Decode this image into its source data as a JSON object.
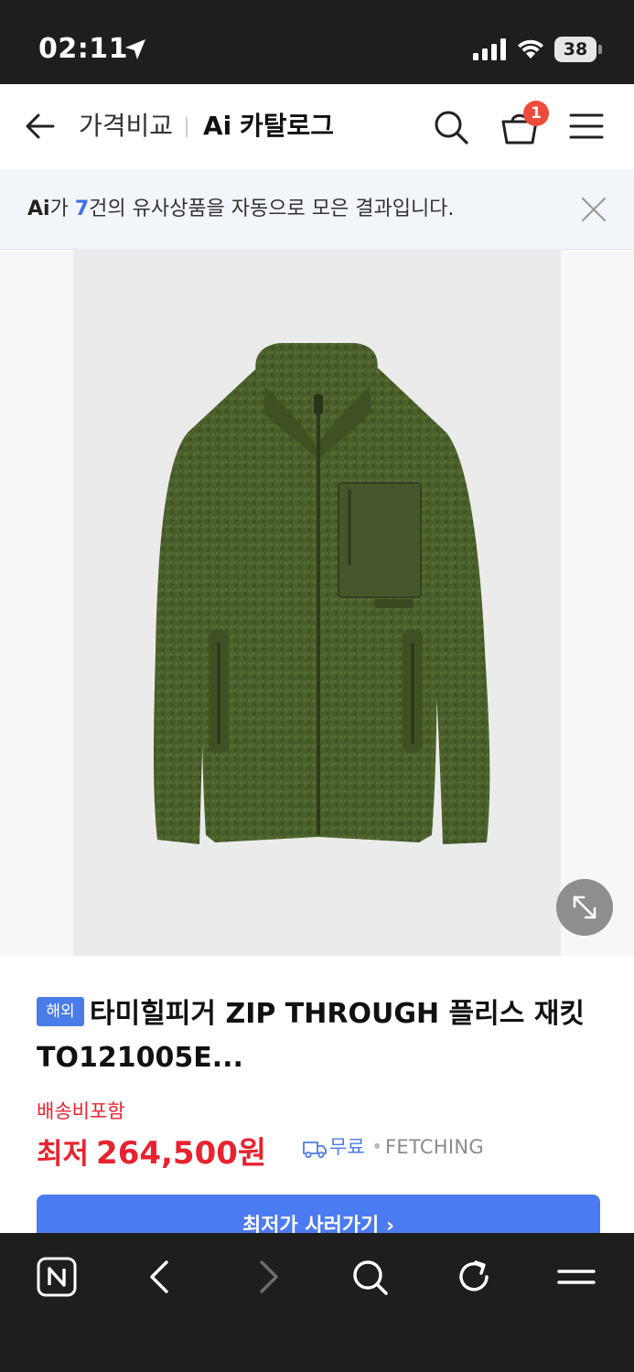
{
  "status_bar": {
    "time": "02:11",
    "battery": "38"
  },
  "header": {
    "title": "가격비교",
    "ai_mark": "Ai",
    "catalog_label": "카탈로그",
    "cart_count": "1"
  },
  "notice": {
    "ai_mark": "Ai",
    "part1": "가 ",
    "count": "7",
    "part2": "건의 유사상품을 자동으로 모은 결과입니다."
  },
  "product": {
    "badge": "해외",
    "title": "타미힐피거 ZIP THROUGH 플리스 재킷 TO121005E...",
    "shipping_note": "배송비포함",
    "price_label": "최저",
    "price": "264,500원",
    "shipping_fee": "무료",
    "separator": "•",
    "seller": "FETCHING",
    "buy_button": "최저가 사러가기 ›"
  },
  "colors": {
    "accent": "#4b7bf0",
    "price_red": "#e8232f",
    "badge_red": "#ef4b3a",
    "jacket_green": "#4a5e2a"
  },
  "icons": {
    "back": "arrow-left-icon",
    "search": "search-icon",
    "cart": "basket-icon",
    "menu": "hamburger-menu-icon",
    "close": "close-icon",
    "expand": "expand-diagonal-icon",
    "truck": "truck-icon",
    "toolbar": [
      "naver-n-icon",
      "back-chevron-icon",
      "forward-chevron-icon",
      "search-icon",
      "refresh-icon",
      "menu-icon"
    ]
  }
}
